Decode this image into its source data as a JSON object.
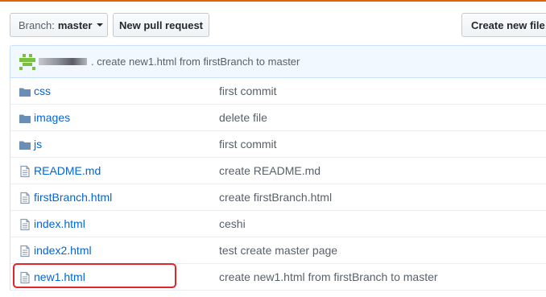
{
  "toolbar": {
    "branch_prefix": "Branch:",
    "branch_name": "master",
    "new_pull_request": "New pull request",
    "create_new_file": "Create new file"
  },
  "latest_commit": {
    "message": ". create new1.html from firstBranch to master"
  },
  "files": [
    {
      "name": "css",
      "type": "folder",
      "message": "first commit"
    },
    {
      "name": "images",
      "type": "folder",
      "message": "delete file"
    },
    {
      "name": "js",
      "type": "folder",
      "message": "first commit"
    },
    {
      "name": "README.md",
      "type": "file",
      "message": "create README.md"
    },
    {
      "name": "firstBranch.html",
      "type": "file",
      "message": "create firstBranch.html"
    },
    {
      "name": "index.html",
      "type": "file",
      "message": "ceshi"
    },
    {
      "name": "index2.html",
      "type": "file",
      "message": "test create master page"
    },
    {
      "name": "new1.html",
      "type": "file",
      "message": "create new1.html from firstBranch to master"
    }
  ],
  "colors": {
    "accent": "#e36209",
    "link": "#0366d6",
    "icon": "#6a8fb5",
    "highlight": "#e0262b",
    "commit_bar_bg": "#f1f8ff"
  }
}
